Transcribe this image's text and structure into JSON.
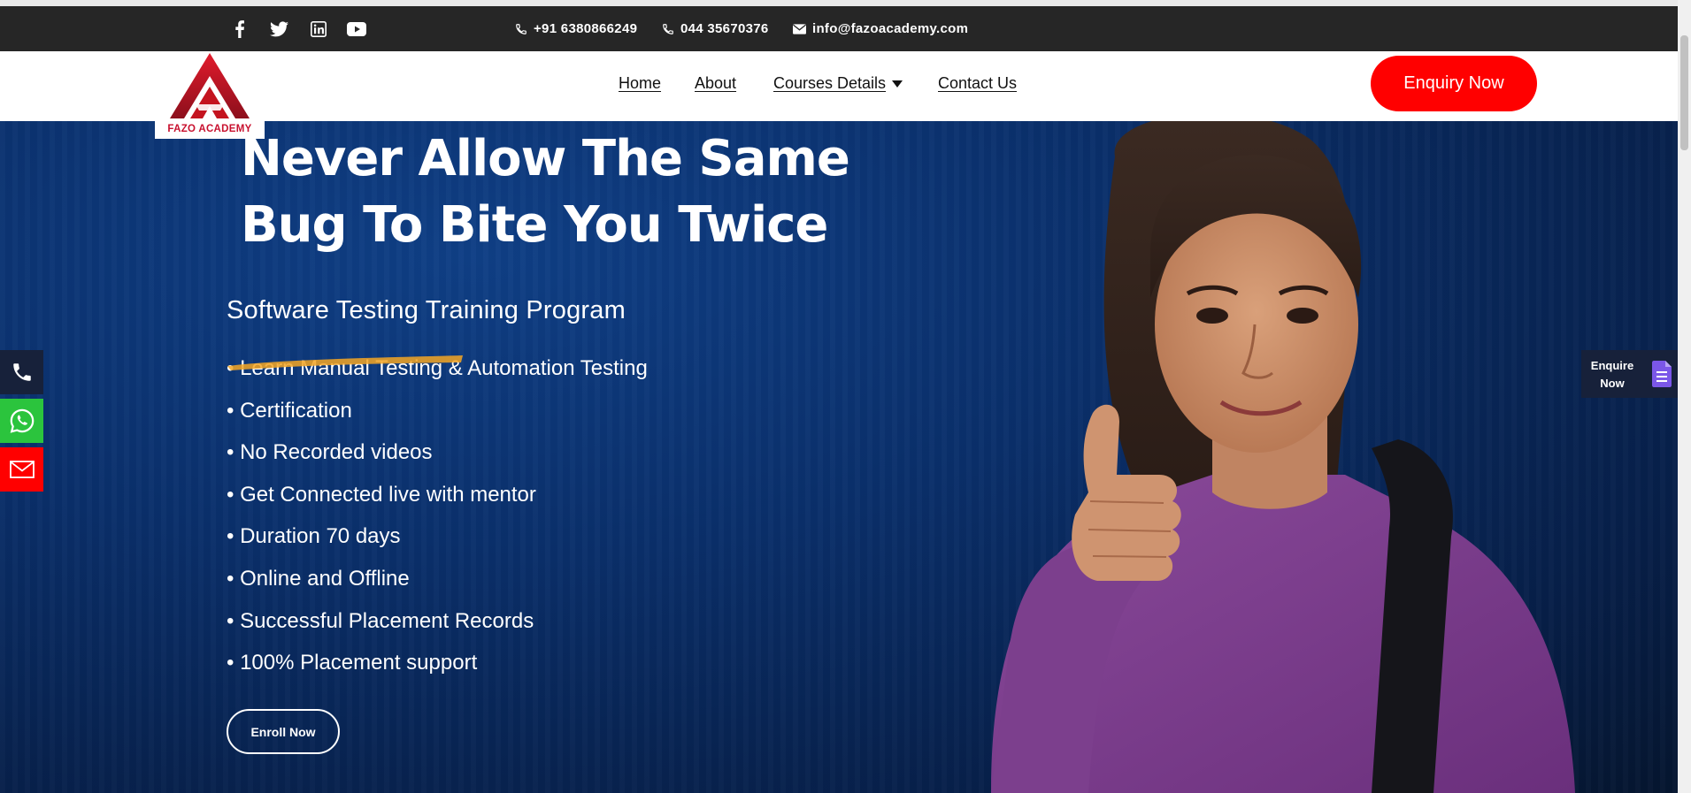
{
  "topbar": {
    "social_icons": [
      "facebook-icon",
      "twitter-icon",
      "linkedin-icon",
      "youtube-icon"
    ],
    "phone1": "+91 6380866249",
    "phone2": "044 35670376",
    "email": "info@fazoacademy.com"
  },
  "logo": {
    "text": "FAZO ACADEMY"
  },
  "nav": {
    "items": [
      "Home",
      "About",
      "Courses Details",
      "Contact Us"
    ],
    "enquiry_button": "Enquiry Now"
  },
  "hero": {
    "headline_line1": "Never Allow The Same",
    "headline_line2": "Bug To Bite You Twice",
    "subtitle": "Software Testing Training Program",
    "features": [
      "• Learn Manual Testing & Automation Testing",
      "• Certification",
      "• No Recorded videos",
      "• Get Connected live with mentor",
      "• Duration 70 days",
      "• Online and Offline",
      "• Successful Placement Records",
      "• 100% Placement support"
    ],
    "enroll_button": "Enroll Now"
  },
  "floating": {
    "left_icons": [
      "phone-icon",
      "whatsapp-icon",
      "mail-icon"
    ],
    "enquire_tab": {
      "line1": "Enquire",
      "line2": "Now"
    }
  },
  "colors": {
    "topbar": "#262626",
    "accent_red": "#ff0000",
    "hero_bg": "#0a2f6a",
    "whatsapp_green": "#25d366",
    "brush_orange": "#f5a623",
    "enquire_icon": "#6b4fd8"
  }
}
